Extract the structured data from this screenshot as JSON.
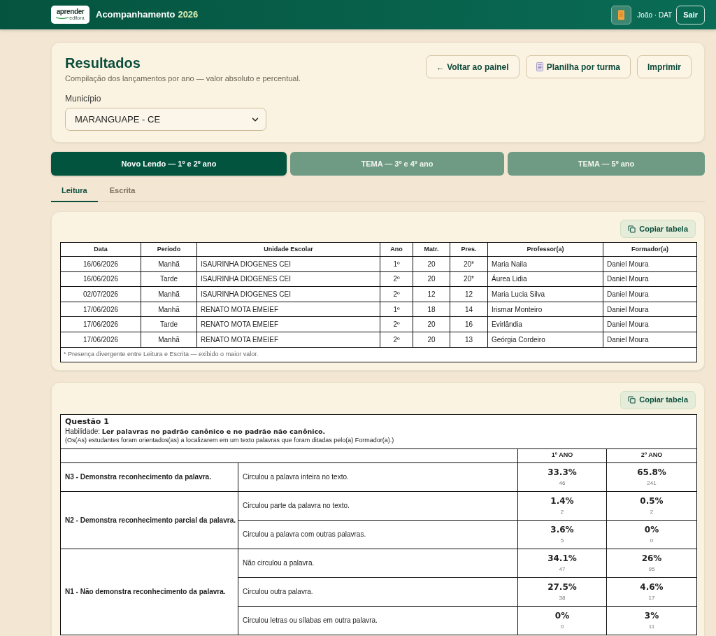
{
  "header": {
    "logo_text": "aprender",
    "logo_tagline": "editora",
    "title": "Acompanhamento",
    "title_year": "2026",
    "user": "João · DAT",
    "logout_button": "Sair"
  },
  "results": {
    "title": "Resultados",
    "subtitle": "Compilação dos lançamentos por ano — valor absoluto e percentual.",
    "actions": [
      {
        "label": "← Voltar ao painel",
        "kind": "plain"
      },
      {
        "label": "Planilha por turma",
        "kind": "sheet"
      },
      {
        "label": "Imprimir",
        "kind": "plain"
      }
    ],
    "filter": {
      "label": "Município",
      "value": "MARANGUAPE - CE"
    }
  },
  "program_tabs": [
    {
      "label": "Novo Lendo — 1º e 2º ano",
      "selected": true
    },
    {
      "label": "TEMA — 3º e 4º ano",
      "selected": false
    },
    {
      "label": "TEMA — 5º ano",
      "selected": false
    }
  ],
  "skill_tabs": [
    {
      "label": "Leitura",
      "selected": true
    },
    {
      "label": "Escrita",
      "selected": false
    }
  ],
  "classes_table": {
    "copy_button": "Copiar tabela",
    "columns": [
      "Data",
      "Período",
      "Unidade Escolar",
      "Ano",
      "Matr.",
      "Pres.",
      "Professor(a)",
      "Formador(a)"
    ],
    "rows": [
      [
        "16/06/2026",
        "Manhã",
        "ISAURINHA DIOGENES CEI",
        "1º",
        "20",
        "20*",
        "Maria Naila",
        "Daniel Moura"
      ],
      [
        "16/06/2026",
        "Tarde",
        "ISAURINHA DIOGENES CEI",
        "2º",
        "20",
        "20*",
        "Áurea Lidia",
        "Daniel Moura"
      ],
      [
        "02/07/2026",
        "Manhã",
        "ISAURINHA DIOGENES CEI",
        "2º",
        "12",
        "12",
        "Maria Lucia Silva",
        "Daniel Moura"
      ],
      [
        "17/06/2026",
        "Manhã",
        "RENATO MOTA EMEIEF",
        "1º",
        "18",
        "14",
        "Irismar Monteiro",
        "Daniel Moura"
      ],
      [
        "17/06/2026",
        "Tarde",
        "RENATO MOTA EMEIEF",
        "2º",
        "20",
        "16",
        "Evirlândia",
        "Daniel Moura"
      ],
      [
        "17/06/2026",
        "Manhã",
        "RENATO MOTA EMEIEF",
        "2º",
        "20",
        "13",
        "Geórgia Cordeiro",
        "Daniel Moura"
      ]
    ],
    "footnote": "* Presença divergente entre Leitura e Escrita — exibido o maior valor."
  },
  "question_table": {
    "copy_button": "Copiar tabela",
    "title": "Questão 1",
    "skill": "Habilidade: **Ler palavras no padrão canônico e no padrão não canônico.**",
    "instruction": "(Os(As) estudantes foram orientados(as) a localizarem em um texto palavras que foram ditadas pelo(a) Formador(a).)",
    "columns": [
      "1º ANO",
      "2º ANO"
    ],
    "levels": [
      {
        "label": "N3 - Demonstra reconhecimento da palavra.",
        "answers": [
          {
            "text": "Circulou a palavra inteira no texto.",
            "values": [
              {
                "percent": "33.3%",
                "count": "46"
              },
              {
                "percent": "65.8%",
                "count": "241"
              }
            ]
          }
        ]
      },
      {
        "label": "N2 - Demonstra reconhecimento parcial da palavra.",
        "answers": [
          {
            "text": "Circulou parte da palavra no texto.",
            "values": [
              {
                "percent": "1.4%",
                "count": "2"
              },
              {
                "percent": "0.5%",
                "count": "2"
              }
            ]
          },
          {
            "text": "Circulou a palavra com outras palavras.",
            "values": [
              {
                "percent": "3.6%",
                "count": "5"
              },
              {
                "percent": "0%",
                "count": "0"
              }
            ]
          }
        ]
      },
      {
        "label": "N1 - Não demonstra reconhecimento da palavra.",
        "answers": [
          {
            "text": "Não circulou a palavra.",
            "values": [
              {
                "percent": "34.1%",
                "count": "47"
              },
              {
                "percent": "26%",
                "count": "95"
              }
            ]
          },
          {
            "text": "Circulou outra palavra.",
            "values": [
              {
                "percent": "27.5%",
                "count": "38"
              },
              {
                "percent": "4.6%",
                "count": "17"
              }
            ]
          },
          {
            "text": "Circulou letras ou sílabas em outra palavra.",
            "values": [
              {
                "percent": "0%",
                "count": "0"
              },
              {
                "percent": "3%",
                "count": "11"
              }
            ]
          }
        ]
      }
    ]
  }
}
